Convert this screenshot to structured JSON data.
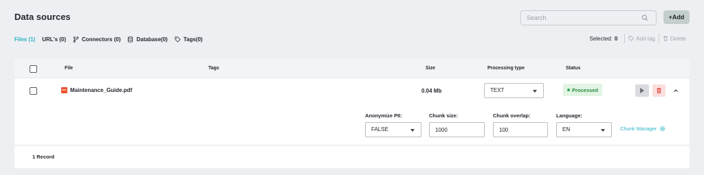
{
  "header": {
    "title": "Data sources",
    "search_placeholder": "Search",
    "add_label": "+Add"
  },
  "tabs": [
    {
      "label": "Files (1)",
      "icon": "",
      "active": true
    },
    {
      "label": "URL's (0)",
      "icon": ""
    },
    {
      "label": "Connectors (0)",
      "icon": "branch-icon"
    },
    {
      "label": "Database(0)",
      "icon": "database-icon"
    },
    {
      "label": "Tags(0)",
      "icon": "tag-icon"
    }
  ],
  "toolbar": {
    "selected_label": "Selected:",
    "selected_count": "0",
    "add_tag_label": "Add tag",
    "delete_label": "Delete"
  },
  "table": {
    "columns": {
      "file": "File",
      "tags": "Tags",
      "size": "Size",
      "processing_type": "Processing type",
      "status": "Status"
    },
    "rows": [
      {
        "file_name": "Maintenance_Guide.pdf",
        "size": "0.04 Mb",
        "processing_type": "TEXT",
        "status": "Processed",
        "details": {
          "anonymize_label": "Anonymize PII:",
          "anonymize_value": "FALSE",
          "chunk_size_label": "Chunk size:",
          "chunk_size_value": "1000",
          "chunk_overlap_label": "Chunk overlap:",
          "chunk_overlap_value": "100",
          "language_label": "Language:",
          "language_value": "EN",
          "chunk_manager_label": "Chunk Manager"
        }
      }
    ],
    "record_count": "1 Record"
  },
  "colors": {
    "accent": "#2bb3c4",
    "status_green": "#2a8a3e",
    "pdf_red": "#e8552f",
    "delete_bg": "#fbdede"
  }
}
